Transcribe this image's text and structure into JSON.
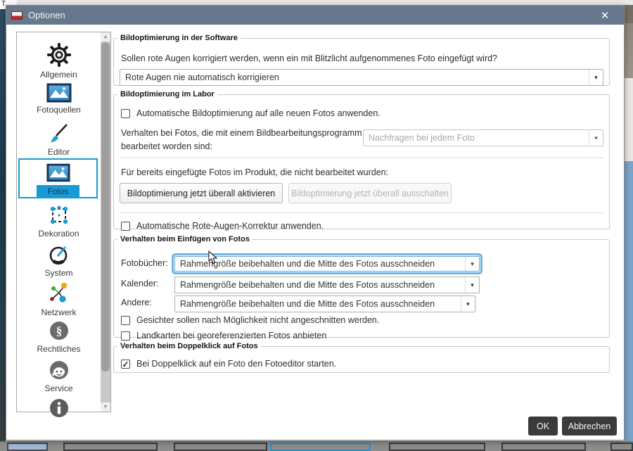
{
  "background": {
    "fragment_text": "T"
  },
  "window": {
    "title": "Optionen"
  },
  "glyphs": {
    "close": "✕",
    "dropdown_arrow": "▾",
    "scroll_up": "▲",
    "scroll_down": "▼",
    "check": "✓"
  },
  "colors": {
    "titlebar": "#67778c",
    "accent_blue": "#1a9ad2",
    "dark_button": "#3b3b3d",
    "focus_ring": "#6fb5e2"
  },
  "sidebar": {
    "items": [
      {
        "label": "Allgemein"
      },
      {
        "label": "Fotoquellen"
      },
      {
        "label": "Editor"
      },
      {
        "label": "Fotos",
        "selected": true
      },
      {
        "label": "Dekoration"
      },
      {
        "label": "System"
      },
      {
        "label": "Netzwerk"
      },
      {
        "label": "Rechtliches"
      },
      {
        "label": "Service"
      }
    ]
  },
  "sections": {
    "software": {
      "legend": "Bildoptimierung in der Software",
      "question": "Sollen rote Augen korrigiert werden, wenn ein mit Blitzlicht aufgenommenes Foto eingefügt wird?",
      "dropdown_value": "Rote Augen nie automatisch korrigieren"
    },
    "labor": {
      "legend": "Bildoptimierung im Labor",
      "checkbox_auto": "Automatische Bildoptimierung auf alle neuen Fotos anwenden.",
      "behavior_label": "Verhalten bei Fotos, die mit einem Bildbearbeitungsprogramm bearbeitet worden sind:",
      "behavior_dropdown_value": "Nachfragen bei jedem Foto",
      "inserted_label": "Für bereits eingefügte Fotos im Produkt, die nicht bearbeitet wurden:",
      "btn_activate": "Bildoptimierung jetzt überall aktivieren",
      "btn_deactivate": "Bildoptimierung jetzt überall ausschalten",
      "checkbox_redeye": "Automatische Rote-Augen-Korrektur anwenden."
    },
    "insert": {
      "legend": "Verhalten beim Einfügen von Fotos",
      "rows": [
        {
          "label": "Fotobücher:",
          "value": "Rahmengröße beibehalten und die Mitte des Fotos ausschneiden"
        },
        {
          "label": "Kalender:",
          "value": "Rahmengröße beibehalten und die Mitte des Fotos ausschneiden"
        },
        {
          "label": "Andere:",
          "value": "Rahmengröße beibehalten und die Mitte des Fotos ausschneiden"
        }
      ],
      "checkbox_faces": "Gesichter sollen nach Möglichkeit nicht angeschnitten werden.",
      "checkbox_maps": "Landkarten bei georeferenzierten Fotos anbieten"
    },
    "doubleclick": {
      "legend": "Verhalten beim Doppelklick auf Fotos",
      "checkbox_editor": "Bei Doppelklick auf ein Foto den Fotoeditor starten."
    }
  },
  "footer": {
    "ok": "OK",
    "cancel": "Abbrechen"
  }
}
